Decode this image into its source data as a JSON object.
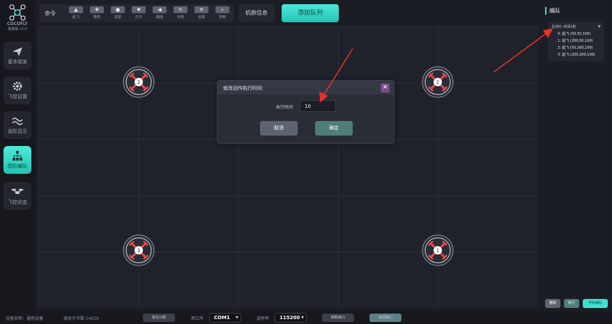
{
  "app": {
    "brand": "COCOFLY",
    "version": "极客版 v1.0"
  },
  "sidebar": {
    "items": [
      {
        "label": "基本收发",
        "icon": "send-icon"
      },
      {
        "label": "飞控设置",
        "icon": "gear-icon"
      },
      {
        "label": "波形显示",
        "icon": "wave-icon"
      },
      {
        "label": "图形编队",
        "icon": "formation-icon"
      },
      {
        "label": "飞控状态",
        "icon": "drone-icon"
      }
    ],
    "active_index": 3
  },
  "toolbar": {
    "label": "命令",
    "buttons": [
      "起飞",
      "降落",
      "返航",
      "灯光",
      "翻滚",
      "环绕",
      "设置",
      "搜索"
    ],
    "cluster_label": "机群信息",
    "add_queue_label": "添加队列"
  },
  "canvas": {
    "drones": [
      {
        "number": "2"
      },
      {
        "number": "2"
      },
      {
        "number": "3"
      },
      {
        "number": "1"
      }
    ]
  },
  "modal": {
    "title": "修改动作执行时间",
    "field_label": "执行时间",
    "field_value": "10",
    "cancel_label": "取消",
    "ok_label": "确定"
  },
  "right_panel": {
    "title": "编队",
    "queue_header": "队形0. 时间1秒",
    "items": [
      "0: 起飞 (50,50,100)",
      "1: 起飞 (200,50,100)",
      "2: 起飞 (50,200,100)",
      "3: 起飞 (200,200,100)"
    ],
    "buttons": [
      "删除",
      "执行",
      "开始编队"
    ]
  },
  "statusbar": {
    "device_text": "设备名称：通用设备",
    "bytes_text": "接收字节数 14250",
    "reset_count_label": "复位计数",
    "port_label": "串口号",
    "port_value": "COM1",
    "baud_label": "波特率",
    "baud_value": "115200",
    "refresh_port_label": "刷新串口",
    "close_port_label": "关闭串口"
  },
  "colors": {
    "accent": "#3fe0cf",
    "background": "#1b1d24",
    "panel": "#24272f",
    "drone_red": "#e84a4a",
    "annotation_red": "#e8302a"
  }
}
